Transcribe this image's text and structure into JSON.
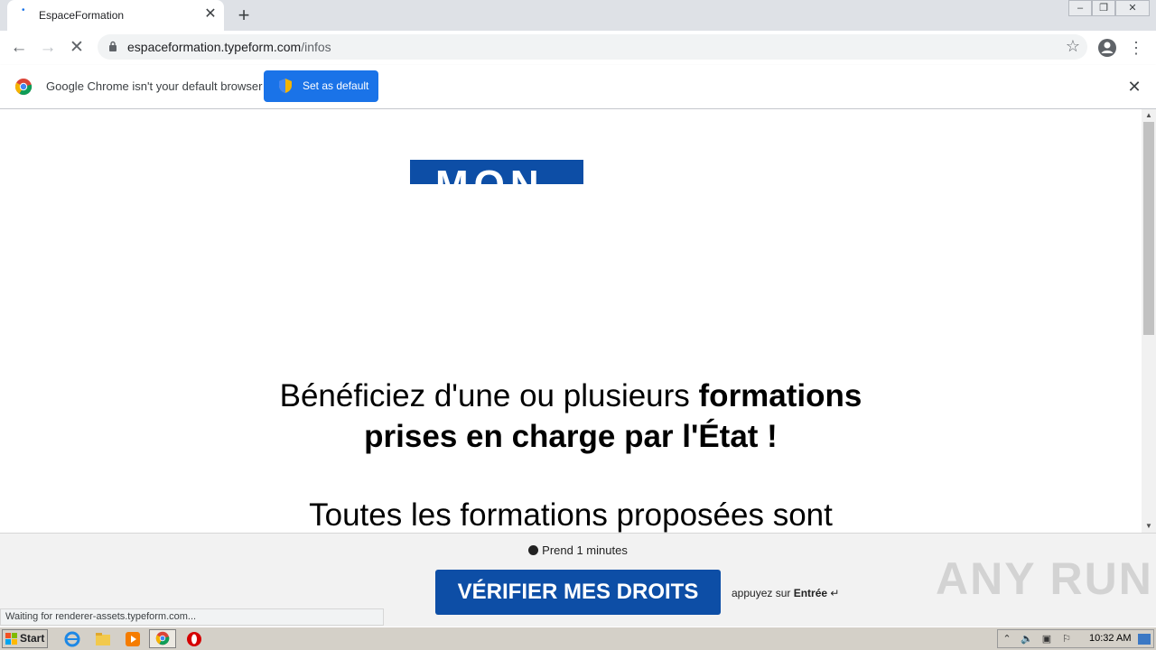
{
  "browser": {
    "tab_title": "EspaceFormation",
    "url_domain": "espaceformation.typeform.com",
    "url_path": "/infos",
    "infobar_text": "Google Chrome isn't your default browser",
    "set_default_label": "Set as default",
    "status_text": "Waiting for renderer-assets.typeform.com..."
  },
  "page": {
    "logo_text": "MON",
    "headline_regular": "Bénéficiez d'une ou plusieurs ",
    "headline_bold_1": "formations",
    "headline_bold_2": "prises en charge par l'État !",
    "subline": "Toutes les formations proposées sont",
    "duration": "Prend 1 minutes",
    "cta_label": "VÉRIFIER MES DROITS",
    "press_prefix": "appuyez sur ",
    "press_key": "Entrée",
    "press_symbol": "↵"
  },
  "watermark": "ANY RUN",
  "taskbar": {
    "start_label": "Start",
    "clock": "10:32 AM"
  },
  "icons": {
    "back": "arrow-left",
    "forward": "arrow-right",
    "reload": "stop-x",
    "lock": "lock",
    "bookmark": "star",
    "profile": "account-circle",
    "menu": "kebab",
    "close": "x"
  },
  "colors": {
    "accent_blue": "#1a73e8",
    "brand_blue": "#0d4ea6"
  }
}
